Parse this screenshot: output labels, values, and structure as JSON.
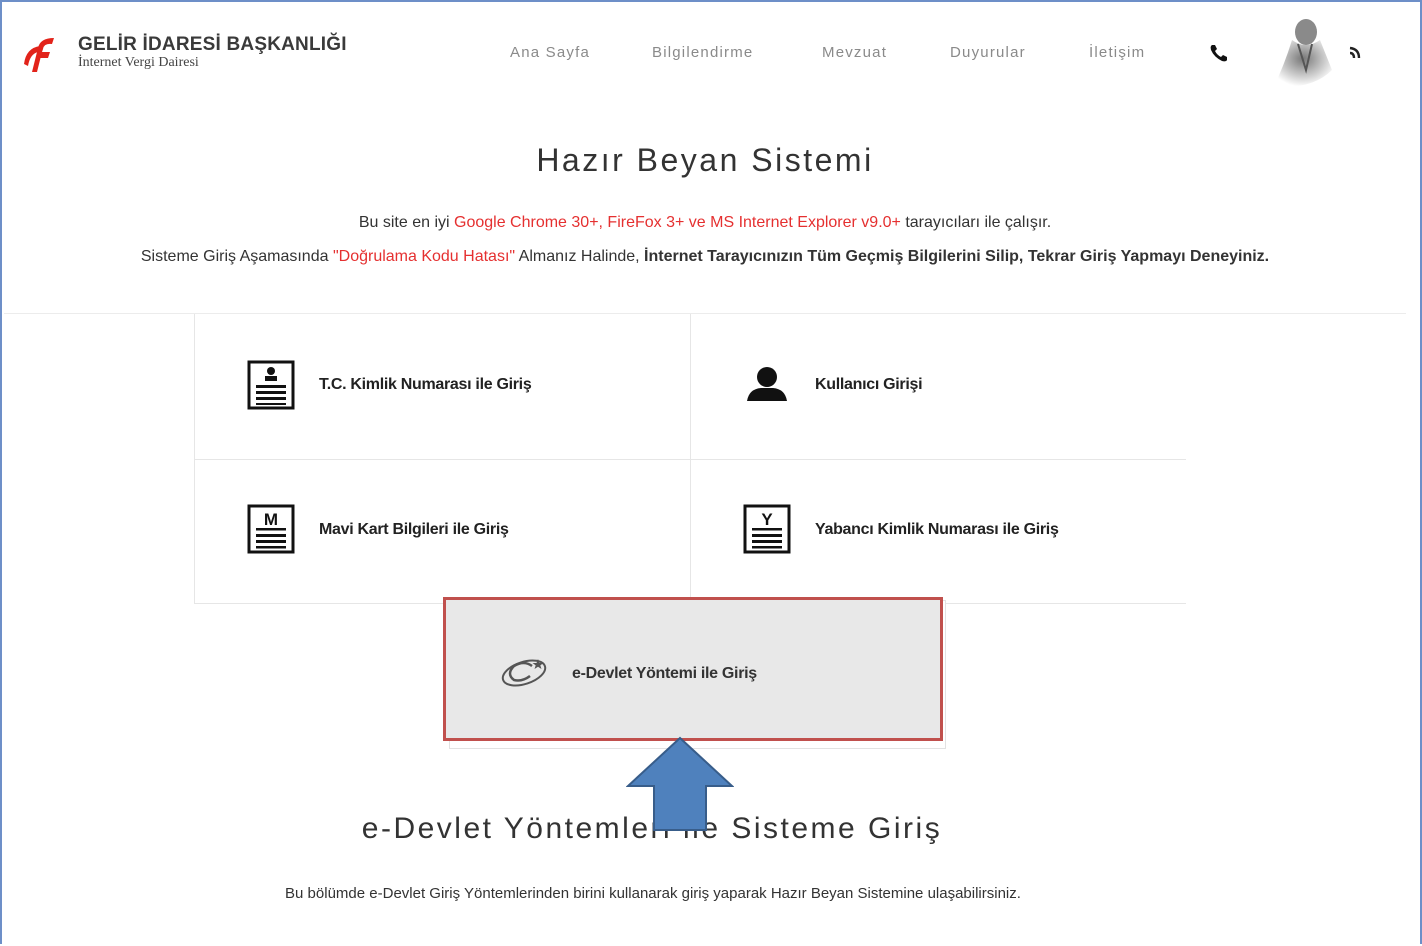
{
  "header": {
    "brand_title": "GELİR İDARESİ BAŞKANLIĞI",
    "brand_subtitle": "İnternet Vergi Dairesi",
    "nav": [
      {
        "label": "Ana Sayfa"
      },
      {
        "label": "Bilgilendirme"
      },
      {
        "label": "Mevzuat"
      },
      {
        "label": "Duyurular"
      },
      {
        "label": "İletişim"
      }
    ],
    "icons": [
      "phone-icon",
      "portrait-image",
      "rss-icon"
    ]
  },
  "main": {
    "title": "Hazır Beyan Sistemi",
    "notice1": {
      "pre": "Bu site en iyi ",
      "highlight": "Google Chrome 30+, FireFox 3+ ve MS Internet Explorer v9.0+",
      "post": " tarayıcıları ile çalışır."
    },
    "notice2": {
      "pre": "Sisteme Giriş Aşamasında ",
      "highlight": "\"Doğrulama Kodu Hatası\"",
      "mid": " Almanız Halinde, ",
      "bold": "İnternet Tarayıcınızın Tüm Geçmiş Bilgilerini Silip, Tekrar Giriş Yapmayı Deneyiniz."
    }
  },
  "login_options": [
    {
      "label": "T.C. Kimlik Numarası ile Giriş",
      "icon": "id-card-icon"
    },
    {
      "label": "Kullanıcı Girişi",
      "icon": "user-icon"
    },
    {
      "label": "Mavi Kart Bilgileri ile Giriş",
      "icon": "m-card-icon",
      "letter": "M"
    },
    {
      "label": "Yabancı Kimlik Numarası ile Giriş",
      "icon": "y-card-icon",
      "letter": "Y"
    }
  ],
  "edevlet": {
    "label": "e-Devlet Yöntemi ile Giriş",
    "icon": "edevlet-logo-icon"
  },
  "section": {
    "title": "e-Devlet Yöntemleri ile Sisteme Giriş",
    "description": "Bu bölümde e-Devlet Giriş Yöntemlerinden birini kullanarak giriş yaparak Hazır Beyan Sistemine ulaşabilirsiniz."
  },
  "annotation": {
    "highlight_color": "#c0504d",
    "arrow_color": "#4f81bd"
  }
}
